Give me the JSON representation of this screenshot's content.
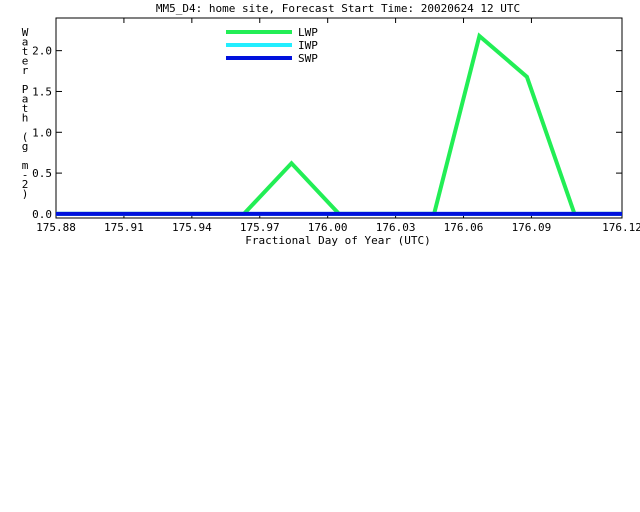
{
  "chart_data": {
    "type": "line",
    "title": "MM5_D4: home site,  Forecast Start Time: 20020624 12 UTC",
    "xlabel": "Fractional Day of Year (UTC)",
    "ylabel": "Water Path (g m-2)",
    "ylabel_glyphs": [
      "W",
      "a",
      "t",
      "e",
      "r",
      "",
      "P",
      "a",
      "t",
      "h",
      "",
      "(",
      "g",
      "",
      "m",
      "-",
      "2",
      ")"
    ],
    "xlim": [
      175.875,
      176.125
    ],
    "ylim": [
      -0.05,
      2.4
    ],
    "x_ticks": [
      175.875,
      175.905,
      175.935,
      175.965,
      175.995,
      176.025,
      176.055,
      176.085,
      176.125
    ],
    "x_tick_labels": [
      "175.88",
      "175.91",
      "175.94",
      "175.97",
      "176.00",
      "176.03",
      "176.06",
      "176.09",
      "176.12"
    ],
    "y_ticks": [
      0.0,
      0.5,
      1.0,
      1.5,
      2.0
    ],
    "y_tick_labels": [
      "0.0",
      "0.5",
      "1.0",
      "1.5",
      "2.0"
    ],
    "legend_position": "top-center",
    "series": [
      {
        "name": "LWP",
        "color": "#22ee55",
        "x": [
          175.875,
          175.958,
          175.979,
          176.0,
          176.042,
          176.062,
          176.083,
          176.104,
          176.125
        ],
        "y": [
          0.0,
          0.0,
          0.62,
          0.0,
          0.0,
          2.18,
          1.68,
          0.0,
          0.0
        ]
      },
      {
        "name": "IWP",
        "color": "#22eeff",
        "x": [
          175.875,
          176.125
        ],
        "y": [
          0.0,
          0.0
        ]
      },
      {
        "name": "SWP",
        "color": "#0011dd",
        "x": [
          175.875,
          176.125
        ],
        "y": [
          0.0,
          0.0
        ]
      }
    ]
  }
}
